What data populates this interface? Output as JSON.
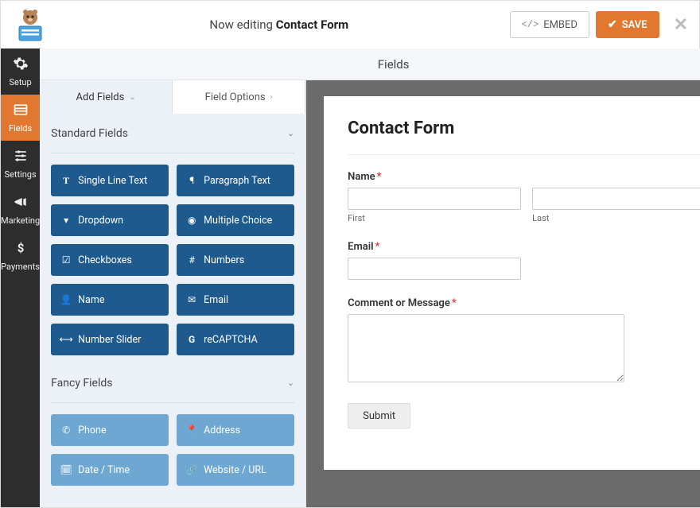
{
  "header": {
    "editing_prefix": "Now editing ",
    "form_name": "Contact Form",
    "embed_label": "EMBED",
    "save_label": "SAVE"
  },
  "sidebar": {
    "items": [
      {
        "id": "setup",
        "label": "Setup"
      },
      {
        "id": "fields",
        "label": "Fields"
      },
      {
        "id": "settings",
        "label": "Settings"
      },
      {
        "id": "marketing",
        "label": "Marketing"
      },
      {
        "id": "payments",
        "label": "Payments"
      }
    ],
    "active": "fields"
  },
  "section_title": "Fields",
  "panel": {
    "tabs": {
      "add": "Add Fields",
      "options": "Field Options",
      "active": "add"
    },
    "groups": [
      {
        "title": "Standard Fields",
        "style": "standard",
        "fields": [
          {
            "icon": "text",
            "label": "Single Line Text"
          },
          {
            "icon": "paragraph",
            "label": "Paragraph Text"
          },
          {
            "icon": "dropdown",
            "label": "Dropdown"
          },
          {
            "icon": "radio",
            "label": "Multiple Choice"
          },
          {
            "icon": "checkbox",
            "label": "Checkboxes"
          },
          {
            "icon": "hash",
            "label": "Numbers"
          },
          {
            "icon": "user",
            "label": "Name"
          },
          {
            "icon": "mail",
            "label": "Email"
          },
          {
            "icon": "slider",
            "label": "Number Slider"
          },
          {
            "icon": "recaptcha",
            "label": "reCAPTCHA"
          }
        ]
      },
      {
        "title": "Fancy Fields",
        "style": "fancy",
        "fields": [
          {
            "icon": "phone",
            "label": "Phone"
          },
          {
            "icon": "pin",
            "label": "Address"
          },
          {
            "icon": "calendar",
            "label": "Date / Time"
          },
          {
            "icon": "link",
            "label": "Website / URL"
          }
        ]
      }
    ]
  },
  "preview": {
    "title": "Contact Form",
    "name_label": "Name",
    "first_sublabel": "First",
    "last_sublabel": "Last",
    "email_label": "Email",
    "message_label": "Comment or Message",
    "submit_label": "Submit"
  }
}
